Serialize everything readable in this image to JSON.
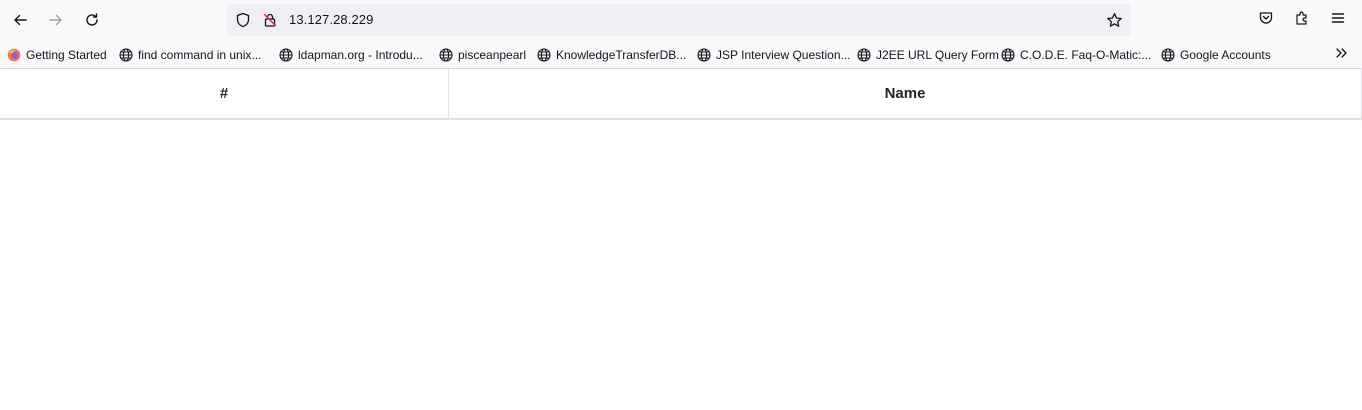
{
  "browser": {
    "url": "13.127.28.229",
    "nav": {
      "back_icon": "arrow-left-icon",
      "forward_icon": "arrow-right-icon",
      "reload_icon": "reload-icon"
    },
    "bookmarks": [
      {
        "label": "Getting Started",
        "icon": "firefox-icon"
      },
      {
        "label": "find command in unix...",
        "icon": "globe-icon"
      },
      {
        "label": "ldapman.org - Introdu...",
        "icon": "globe-icon"
      },
      {
        "label": "pisceanpearl",
        "icon": "globe-icon"
      },
      {
        "label": "KnowledgeTransferDB...",
        "icon": "globe-icon"
      },
      {
        "label": "JSP Interview Question...",
        "icon": "globe-icon"
      },
      {
        "label": "J2EE URL Query Form",
        "icon": "globe-icon"
      },
      {
        "label": "C.O.D.E. Faq-O-Matic:...",
        "icon": "globe-icon"
      },
      {
        "label": "Google Accounts",
        "icon": "globe-icon"
      }
    ]
  },
  "table": {
    "columns": [
      "#",
      "Name"
    ],
    "rows": []
  }
}
